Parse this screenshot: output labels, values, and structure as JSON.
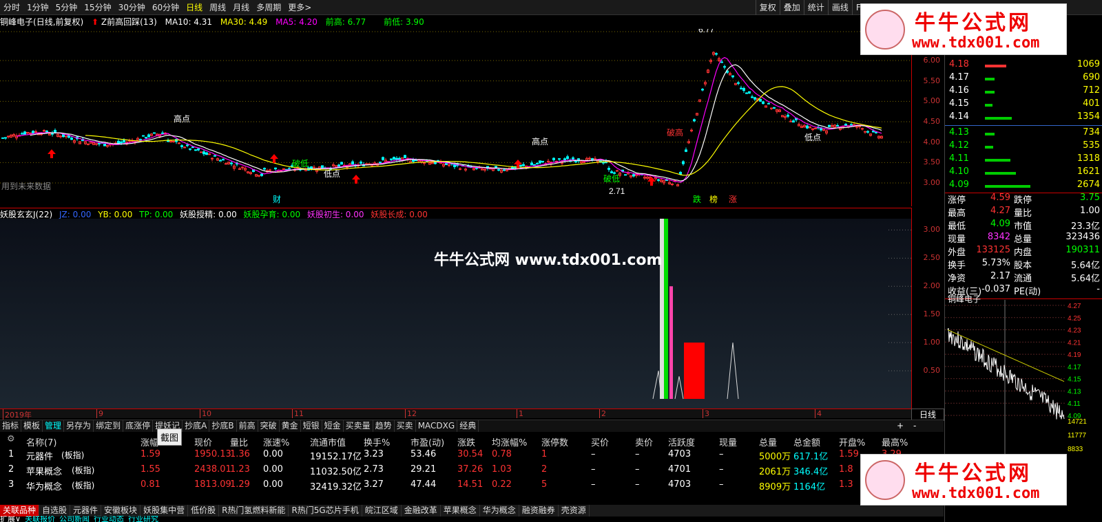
{
  "top_menu": [
    "分时",
    "1分钟",
    "5分钟",
    "15分钟",
    "30分钟",
    "60分钟",
    "日线",
    "周线",
    "月线",
    "多周期",
    "更多>"
  ],
  "top_menu_active": "日线",
  "right_menu": [
    "复权",
    "叠加",
    "统计",
    "画线",
    "F10"
  ],
  "info": {
    "stock": "铜峰电子",
    "mode": "(日线,前复权)",
    "formula": "Z前高回踩(13)",
    "ma10": "MA10: 4.31",
    "ma30": "MA30: 4.49",
    "ma5": "MA5: 4.20",
    "prev_high": "前高: 6.77",
    "prev_low": "前低: 3.90"
  },
  "main_chart": {
    "annotations": [
      "高点",
      "高点",
      "低点",
      "低点",
      "破低",
      "破低",
      "破高",
      "跌",
      "榜",
      "涨",
      "财",
      "用到未来数据",
      "6.77",
      "2.71"
    ],
    "y_ticks": [
      "6.00",
      "5.50",
      "5.00",
      "4.50",
      "4.00",
      "3.50",
      "3.00"
    ]
  },
  "indicator": {
    "name": "妖股玄玄J(22)",
    "jz": "JZ: 0.00",
    "yb": "YB: 0.00",
    "tp": "TP: 0.00",
    "yghj": "妖股授精: 0.00",
    "ygyy": "妖股孕育: 0.00",
    "ygcs": "妖股初生: 0.00",
    "ygzc": "妖股长成: 0.00",
    "y_ticks": [
      "3.00",
      "2.50",
      "2.00",
      "1.50",
      "1.00",
      "0.50"
    ],
    "watermark_text": "牛牛公式网 www.tdx001.com"
  },
  "date_axis": [
    "2019年",
    "9",
    "10",
    "11",
    "12",
    "1",
    "2",
    "3",
    "4"
  ],
  "daily_label": "日线",
  "tabs": [
    "指标",
    "模板",
    "管理",
    "另存为",
    "绑定到",
    "底涨停",
    "提妖记",
    "抄底A",
    "抄底B",
    "前高",
    "突破",
    "黄金",
    "短银",
    "短金",
    "买卖量",
    "趋势",
    "买卖",
    "MACDXG",
    "经典"
  ],
  "tabs_active": "管理",
  "tabs_right": [
    "+",
    "-"
  ],
  "table": {
    "headers": [
      "名称(7)",
      "涨幅",
      "现价",
      "量比",
      "涨速%",
      "流通市值",
      "换手%",
      "市盈(动)",
      "涨跌",
      "均涨幅%",
      "涨停数",
      "买价",
      "卖价",
      "活跃度",
      "现量",
      "总量",
      "总金额",
      "开盘%",
      "最高%"
    ],
    "tooltip": "截图",
    "rows": [
      {
        "idx": "1",
        "name": "元器件",
        "tag": "(板指)",
        "zf": "1.59",
        "price": "1950.13",
        "lb": "1.36",
        "zs": "0.00",
        "ltsz": "19152.17亿",
        "hs": "3.23",
        "syl": "53.46",
        "zd": "30.54",
        "jzf": "0.78",
        "ztsh": "1",
        "mj": "–",
        "maij": "–",
        "hyd": "4703",
        "xl": "–",
        "zl": "5000万",
        "zje": "617.1亿",
        "kp": "1.59",
        "zg": "3.29"
      },
      {
        "idx": "2",
        "name": "苹果概念",
        "tag": "(板指)",
        "zf": "1.55",
        "price": "2438.01",
        "lb": "1.23",
        "zs": "0.00",
        "ltsz": "11032.50亿",
        "hs": "2.73",
        "syl": "29.21",
        "zd": "37.26",
        "jzf": "1.03",
        "ztsh": "2",
        "mj": "–",
        "maij": "–",
        "hyd": "4701",
        "xl": "–",
        "zl": "2061万",
        "zje": "346.4亿",
        "kp": "1.8",
        "zg": ""
      },
      {
        "idx": "3",
        "name": "华为概念",
        "tag": "(板指)",
        "zf": "0.81",
        "price": "1813.09",
        "lb": "1.29",
        "zs": "0.00",
        "ltsz": "32419.32亿",
        "hs": "3.27",
        "syl": "47.44",
        "zd": "14.51",
        "jzf": "0.22",
        "ztsh": "5",
        "mj": "–",
        "maij": "–",
        "hyd": "4703",
        "xl": "–",
        "zl": "8909万",
        "zje": "1164亿",
        "kp": "1.3",
        "zg": ""
      }
    ]
  },
  "bottom_tabs": [
    "关联品种",
    "自选股",
    "元器件",
    "安徽板块",
    "妖股集中营",
    "低价股",
    "R热门氢燃料新能",
    "R热门5G芯片手机",
    "皖江区域",
    "金融改革",
    "苹果概念",
    "华为概念",
    "融资融券",
    "壳资源"
  ],
  "bottom_tabs_active": "关联品种",
  "footer_tabs": [
    "扩展∨",
    "关联报价",
    "公司新闻",
    "行业动态",
    "行业研究"
  ],
  "orderbook": {
    "asks": [
      {
        "price": "4.18",
        "vol": "1069",
        "bar": 0.28
      },
      {
        "price": "4.17",
        "vol": "690",
        "bar": 0.13
      },
      {
        "price": "4.16",
        "vol": "712",
        "bar": 0.13
      },
      {
        "price": "4.15",
        "vol": "401",
        "bar": 0.1
      },
      {
        "price": "4.14",
        "vol": "1354",
        "bar": 0.35
      }
    ],
    "bids": [
      {
        "price": "4.13",
        "vol": "734",
        "bar": 0.13
      },
      {
        "price": "4.12",
        "vol": "535",
        "bar": 0.11
      },
      {
        "price": "4.11",
        "vol": "1318",
        "bar": 0.34
      },
      {
        "price": "4.10",
        "vol": "1621",
        "bar": 0.41
      },
      {
        "price": "4.09",
        "vol": "2674",
        "bar": 0.6
      }
    ]
  },
  "stats": [
    {
      "l1": "涨停",
      "v1": "4.59",
      "l2": "跌停",
      "v2": "3.75",
      "c1": "#ff3333",
      "c2": "#00ff00"
    },
    {
      "l1": "最高",
      "v1": "4.27",
      "l2": "量比",
      "v2": "1.00",
      "c1": "#ff3333",
      "c2": "#ffffff"
    },
    {
      "l1": "最低",
      "v1": "4.09",
      "l2": "市值",
      "v2": "23.3亿",
      "c1": "#00ff00",
      "c2": "#ffffff"
    },
    {
      "l1": "现量",
      "v1": "8342",
      "l2": "总量",
      "v2": "323436",
      "c1": "#ff33ff",
      "c2": "#ffffff"
    },
    {
      "l1": "外盘",
      "v1": "133125",
      "l2": "内盘",
      "v2": "190311",
      "c1": "#ff3333",
      "c2": "#00ff00"
    },
    {
      "l1": "换手",
      "v1": "5.73%",
      "l2": "股本",
      "v2": "5.64亿",
      "c1": "#ffffff",
      "c2": "#ffffff"
    },
    {
      "l1": "净资",
      "v1": "2.17",
      "l2": "流通",
      "v2": "5.64亿",
      "c1": "#ffffff",
      "c2": "#ffffff"
    },
    {
      "l1": "收益(三)",
      "v1": "-0.037",
      "l2": "PE(动)",
      "v2": "-",
      "c1": "#ffffff",
      "c2": "#ffffff"
    }
  ],
  "mini_chart": {
    "title": "铜峰电子",
    "y_ticks": [
      "4.27",
      "4.25",
      "4.23",
      "4.21",
      "4.19",
      "4.17",
      "4.15",
      "4.13",
      "4.11",
      "4.09"
    ],
    "vol_ticks": [
      "14721",
      "11777",
      "8833"
    ]
  },
  "watermark": {
    "title": "牛牛公式网",
    "url": "www.tdx001.com"
  },
  "colors": {
    "up": "#ff3333",
    "down": "#00ffff",
    "green": "#00cc00",
    "yellow": "#ffff00",
    "magenta": "#ff00ff"
  }
}
